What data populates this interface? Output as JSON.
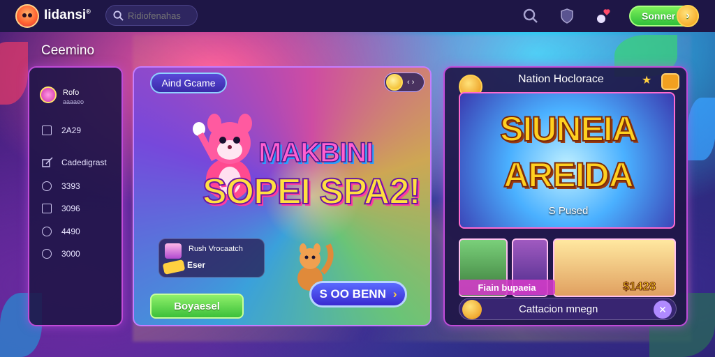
{
  "header": {
    "logo_text": "Iidansi",
    "logo_superscript": "®",
    "search_placeholder": "Ridiofenahas",
    "signin_label": "Sonner",
    "signin_arrow": "›"
  },
  "section_title": "Ceemino",
  "sidebar": {
    "profile_name": "Rofo",
    "profile_sub": "aaaaeo",
    "items": [
      {
        "icon": "square-icon",
        "label": "2A29"
      },
      {
        "icon": "edit-icon",
        "label": "Cadedigrast"
      },
      {
        "icon": "circle-icon",
        "label": "3393"
      },
      {
        "icon": "square-icon",
        "label": "3096"
      },
      {
        "icon": "circle-icon",
        "label": "4490"
      },
      {
        "icon": "circle-icon",
        "label": "3000"
      }
    ]
  },
  "feature": {
    "tag_label": "Aind Gcame",
    "title_line1": "MAKBINI",
    "title_line2": "SOPEI SPA2!",
    "mini_title": "Rush Vrocaatch",
    "mini_sub": "Eser",
    "play_label": "Boyaesel",
    "bet_label": "S OO BENN",
    "bet_arrow": "›"
  },
  "right_panel": {
    "title": "Nation Hoclorace",
    "banner_line1": "SIUNEIA",
    "banner_line2": "AREIDA",
    "banner_sub": "S Pused",
    "thumb_label": "Fiain bupaeia",
    "thumb_price": "$1428",
    "footer_text": "Cattacion mnegn",
    "footer_close": "✕"
  },
  "colors": {
    "topbar": "#1e1646",
    "accent_green": "#3cc03a",
    "accent_gold": "#ffd020",
    "panel_border": "#c04bd8"
  }
}
